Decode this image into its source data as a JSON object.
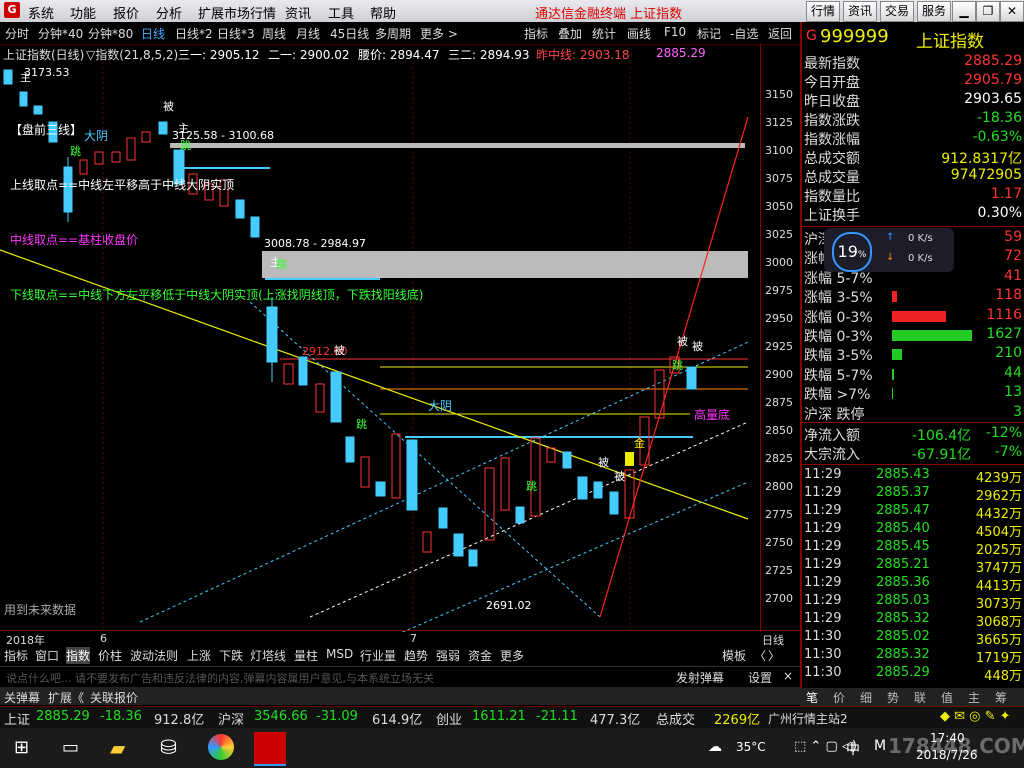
{
  "menu": {
    "logo": "G",
    "items": [
      "系统",
      "功能",
      "报价",
      "分析",
      "扩展市场行情",
      "资讯",
      "工具",
      "帮助"
    ],
    "title": "通达信金融终端  上证指数",
    "buttons": [
      "行情",
      "资讯",
      "交易",
      "服务"
    ]
  },
  "periods": [
    "分时",
    "分钟*40",
    "分钟*80",
    "日线",
    "日线*2",
    "日线*3",
    "周线",
    "月线",
    "45日线",
    "多周期",
    "更多 >"
  ],
  "period_active": "日线",
  "toolbar": [
    "指标",
    "叠加",
    "统计",
    "画线",
    "F10",
    "标记",
    "-自选",
    "返回"
  ],
  "info": {
    "name": "上证指数(日线)",
    "indicator": "▽指数(21,8,5,2)",
    "l1": "三一: 2905.12",
    "l2": "二一: 2900.02",
    "l3": "腰价: 2894.47",
    "l4": "三二: 2894.93",
    "l5": "昨中线: 2903.18",
    "l6": "2885.29"
  },
  "yaxis": [
    "3150",
    "3125",
    "3100",
    "3075",
    "3050",
    "3025",
    "3000",
    "2975",
    "2950",
    "2925",
    "2900",
    "2875",
    "2850",
    "2825",
    "2800",
    "2775",
    "2750",
    "2725",
    "2700"
  ],
  "annotations": {
    "top": "3173.53",
    "box1": "3125.58 - 3100.68",
    "box2": "3008.78 - 2984.97",
    "low": "2691.02",
    "mid": "2912.00",
    "t1": "【盘前三线】",
    "t2": "上线取点==中线左平移高于中线大阴实顶",
    "t3": "中线取点==基柱收盘价",
    "t4": "下线取点==中线下方左平移低于中线大阴实顶(上涨找阴线顶，下跌找阳线底)",
    "dayin": "大阴",
    "dayin2": "大阴",
    "gaoliang": "高量底",
    "future": "用到未来数据",
    "bei": "被",
    "zhu": "主",
    "tiao": "跳",
    "jin": "金"
  },
  "xaxis": {
    "year": "2018年",
    "m6": "6",
    "m7": "7",
    "label": "日线"
  },
  "tabs": [
    "指标",
    "窗口",
    "指数",
    "价柱",
    "波动法则",
    "上涨",
    "下跌",
    "灯塔线",
    "量柱",
    "MSD",
    "行业量",
    "趋势",
    "强弱",
    "资金",
    "更多"
  ],
  "tabs_active": "指数",
  "tab_right": [
    "模板",
    "〈",
    "〉"
  ],
  "bullet": {
    "text": "说点什么吧... 请不要发布广告和违反法律的内容,弹幕内容属用户意见,与本系统立场无关",
    "send": "发射弹幕",
    "settings": "设置",
    "close": "×"
  },
  "lowbar": [
    "关弹幕",
    "扩展《",
    "关联报价"
  ],
  "quote": {
    "code": "999999",
    "name": "上证指数",
    "rows": [
      {
        "l": "最新指数",
        "v": "2885.29",
        "c": "red"
      },
      {
        "l": "今日开盘",
        "v": "2905.79",
        "c": "red"
      },
      {
        "l": "昨日收盘",
        "v": "2903.65",
        "c": "white"
      },
      {
        "l": "指数涨跌",
        "v": "-18.36",
        "c": "green"
      },
      {
        "l": "指数涨幅",
        "v": "-0.63%",
        "c": "green"
      },
      {
        "l": "总成交额",
        "v": "912.8317亿",
        "c": "yellow"
      },
      {
        "l": "总成交量",
        "v": "97472905",
        "c": "yellow"
      },
      {
        "l": "指数量比",
        "v": "1.17",
        "c": "red"
      },
      {
        "l": "上证换手",
        "v": "0.30%",
        "c": "white"
      }
    ]
  },
  "dist": [
    {
      "l": "沪深",
      "v": "59",
      "c": "red",
      "w": 0
    },
    {
      "l": "涨幅",
      "v": "72",
      "c": "red",
      "w": 0
    },
    {
      "l": "涨幅 5-7%",
      "v": "41",
      "c": "red",
      "w": 0
    },
    {
      "l": "涨幅 3-5%",
      "v": "118",
      "c": "red",
      "w": 0.06
    },
    {
      "l": "涨幅 0-3%",
      "v": "1116",
      "c": "red",
      "w": 0.68
    },
    {
      "l": "跌幅 0-3%",
      "v": "1627",
      "c": "green",
      "w": 1.0
    },
    {
      "l": "跌幅 3-5%",
      "v": "210",
      "c": "green",
      "w": 0.13
    },
    {
      "l": "跌幅 5-7%",
      "v": "44",
      "c": "green",
      "w": 0.03
    },
    {
      "l": "跌幅 >7%",
      "v": "13",
      "c": "green",
      "w": 0.01
    },
    {
      "l": "沪深 跌停",
      "v": "3",
      "c": "green",
      "w": 0
    }
  ],
  "overlay": {
    "pct": "19",
    "pct_unit": "%",
    "up": "0 K/s",
    "down": "0 K/s"
  },
  "flow": [
    {
      "l": "净流入额",
      "v": "-106.4亿",
      "p": "-12%"
    },
    {
      "l": "大宗流入",
      "v": "-67.91亿",
      "p": "-7%"
    }
  ],
  "trades": [
    [
      "11:29",
      "2885.43",
      "4239万"
    ],
    [
      "11:29",
      "2885.37",
      "2962万"
    ],
    [
      "11:29",
      "2885.47",
      "4432万"
    ],
    [
      "11:29",
      "2885.40",
      "4504万"
    ],
    [
      "11:29",
      "2885.45",
      "2025万"
    ],
    [
      "11:29",
      "2885.21",
      "3747万"
    ],
    [
      "11:29",
      "2885.36",
      "4413万"
    ],
    [
      "11:29",
      "2885.03",
      "3073万"
    ],
    [
      "11:29",
      "2885.32",
      "3068万"
    ],
    [
      "11:30",
      "2885.02",
      "3665万"
    ],
    [
      "11:30",
      "2885.32",
      "1719万"
    ],
    [
      "11:30",
      "2885.29",
      "448万"
    ]
  ],
  "rtabs": [
    "笔",
    "价",
    "细",
    "势",
    "联",
    "值",
    "主",
    "筹"
  ],
  "status": {
    "s1": "上证",
    "s1v": "2885.29",
    "s1c": "-18.36",
    "s1a": "912.8亿",
    "s2": "沪深",
    "s2v": "3546.66",
    "s2c": "-31.09",
    "s2a": "614.9亿",
    "s3": "创业",
    "s3v": "1611.21",
    "s3c": "-21.11",
    "s3a": "477.3亿",
    "s4": "总成交",
    "s4v": "2269亿",
    "s5": "广州行情主站2"
  },
  "taskbar": {
    "weather": "35°C",
    "ime": "中",
    "time": "17:40",
    "date": "2018/7/26",
    "watermark": "178448.COM"
  }
}
